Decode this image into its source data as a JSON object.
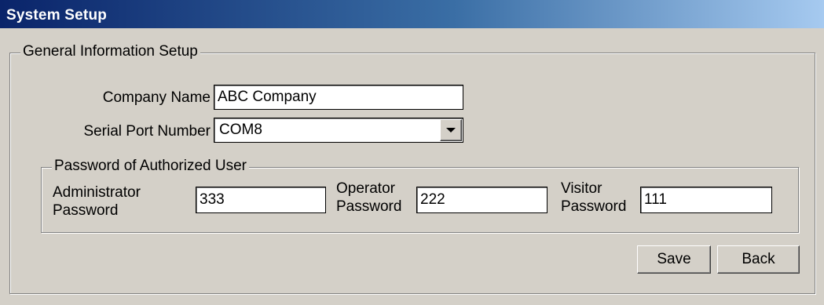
{
  "window": {
    "title": "System Setup"
  },
  "general": {
    "group_title": "General Information Setup",
    "company_name_label": "Company Name",
    "company_name_value": "ABC Company",
    "serial_port_label": "Serial Port Number",
    "serial_port_value": "COM8"
  },
  "passwords": {
    "group_title": "Password of Authorized User",
    "admin_label_line1": "Administrator",
    "admin_label_line2": "Password",
    "admin_value": "333",
    "operator_label_line1": "Operator",
    "operator_label_line2": "Password",
    "operator_value": "222",
    "visitor_label_line1": "Visitor",
    "visitor_label_line2": "Password",
    "visitor_value": "111"
  },
  "buttons": {
    "save": "Save",
    "back": "Back"
  },
  "icons": {
    "dropdown": "chevron-down-icon"
  },
  "colors": {
    "titlebar_start": "#0a246a",
    "titlebar_end": "#a6caf0",
    "face": "#d4d0c8"
  }
}
